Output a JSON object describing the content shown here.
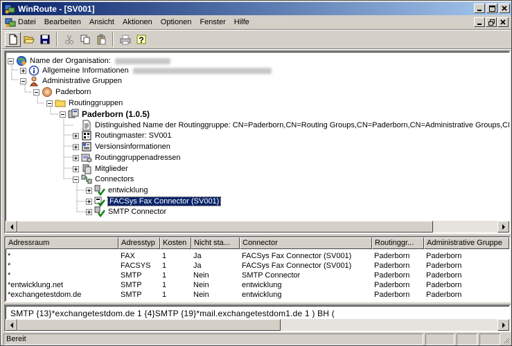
{
  "window": {
    "title": "WinRoute - [SV001]"
  },
  "menu": [
    {
      "label": "Datei"
    },
    {
      "label": "Bearbeiten"
    },
    {
      "label": "Ansicht"
    },
    {
      "label": "Aktionen"
    },
    {
      "label": "Optionen"
    },
    {
      "label": "Fenster"
    },
    {
      "label": "Hilfe"
    }
  ],
  "toolbar": [
    "new-icon",
    "open-icon",
    "save-icon",
    "cut-icon",
    "copy-icon",
    "paste-icon",
    "print-icon",
    "help-icon"
  ],
  "tree": [
    {
      "label": "Name der Organisation:",
      "icon": "organization-icon"
    },
    {
      "label": "Allgemeine Informationen",
      "icon": "info-icon"
    },
    {
      "label": "Administrative Gruppen",
      "icon": "admin-groups-icon"
    },
    {
      "label": "Paderborn",
      "icon": "admin-group-icon"
    },
    {
      "label": "Routinggruppen",
      "icon": "folder-icon"
    },
    {
      "label": "Paderborn (1.0.5)",
      "icon": "routing-group-icon"
    },
    {
      "label": "Distinguished Name der Routinggruppe: CN=Paderborn,CN=Routing Groups,CN=Paderborn,CN=Administrative Groups,CN=",
      "icon": "document-icon"
    },
    {
      "label": "Routingmaster: SV001",
      "icon": "server-icon"
    },
    {
      "label": "Versionsinformationen",
      "icon": "version-icon"
    },
    {
      "label": "Routinggruppenadressen",
      "icon": "addresses-icon"
    },
    {
      "label": "Mitglieder",
      "icon": "members-icon"
    },
    {
      "label": "Connectors",
      "icon": "connectors-icon"
    },
    {
      "label": "entwicklung",
      "icon": "connector-icon"
    },
    {
      "label": "FACSys Fax Connector (SV001)",
      "icon": "fax-connector-icon"
    },
    {
      "label": "SMTP Connector",
      "icon": "connector-icon"
    }
  ],
  "list": {
    "headers": [
      "Adressraum",
      "Adresstyp",
      "Kosten",
      "Nicht sta...",
      "Connector",
      "Routinggr...",
      "Administrative Gruppe"
    ],
    "rows": [
      [
        "*",
        "FAX",
        "1",
        "Ja",
        "FACSys Fax Connector (SV001)",
        "Paderborn",
        "Paderborn"
      ],
      [
        "*",
        "FACSYS",
        "1",
        "Ja",
        "FACSys Fax Connector (SV001)",
        "Paderborn",
        "Paderborn"
      ],
      [
        "*",
        "SMTP",
        "1",
        "Nein",
        "SMTP Connector",
        "Paderborn",
        "Paderborn"
      ],
      [
        "*entwicklung.net",
        "SMTP",
        "1",
        "Nein",
        "entwicklung",
        "Paderborn",
        "Paderborn"
      ],
      [
        "*exchangetestdom.de",
        "SMTP",
        "1",
        "Nein",
        "entwicklung",
        "Paderborn",
        "Paderborn"
      ]
    ]
  },
  "detail_text": "SMTP {13}*exchangetestdom.de 1  {4}SMTP {19}*mail.exchangetestdom1.de 1 ) BH (",
  "status": {
    "text": "Bereit"
  },
  "colors": {
    "titlebar_start": "#0a246a",
    "titlebar_end": "#a6caf0",
    "selection": "#0a246a",
    "face": "#d4d0c8"
  }
}
